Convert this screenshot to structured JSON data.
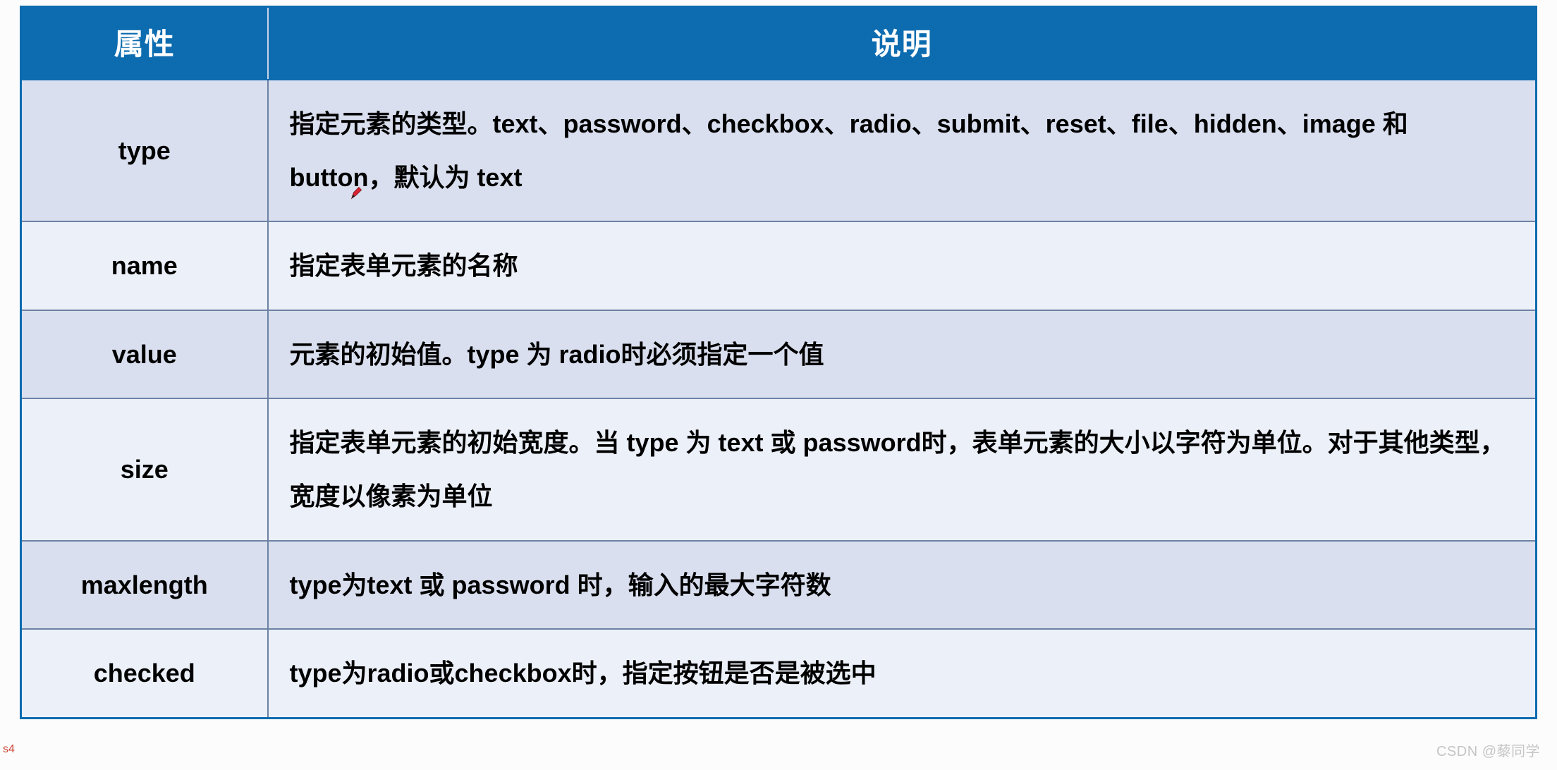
{
  "table": {
    "headers": {
      "attr": "属性",
      "desc": "说明"
    },
    "rows": [
      {
        "attr": "type",
        "desc": "指定元素的类型。text、password、checkbox、radio、submit、reset、file、hidden、image 和 button，默认为 text"
      },
      {
        "attr": "name",
        "desc": "指定表单元素的名称"
      },
      {
        "attr": "value",
        "desc": "元素的初始值。type 为 radio时必须指定一个值"
      },
      {
        "attr": "size",
        "desc": "指定表单元素的初始宽度。当 type 为 text 或 password时，表单元素的大小以字符为单位。对于其他类型，宽度以像素为单位"
      },
      {
        "attr": "maxlength",
        "desc": "type为text 或 password 时，输入的最大字符数"
      },
      {
        "attr": "checked",
        "desc": "type为radio或checkbox时，指定按钮是否是被选中"
      }
    ]
  },
  "watermark": "CSDN @藜同学",
  "corner_mark": "s4"
}
